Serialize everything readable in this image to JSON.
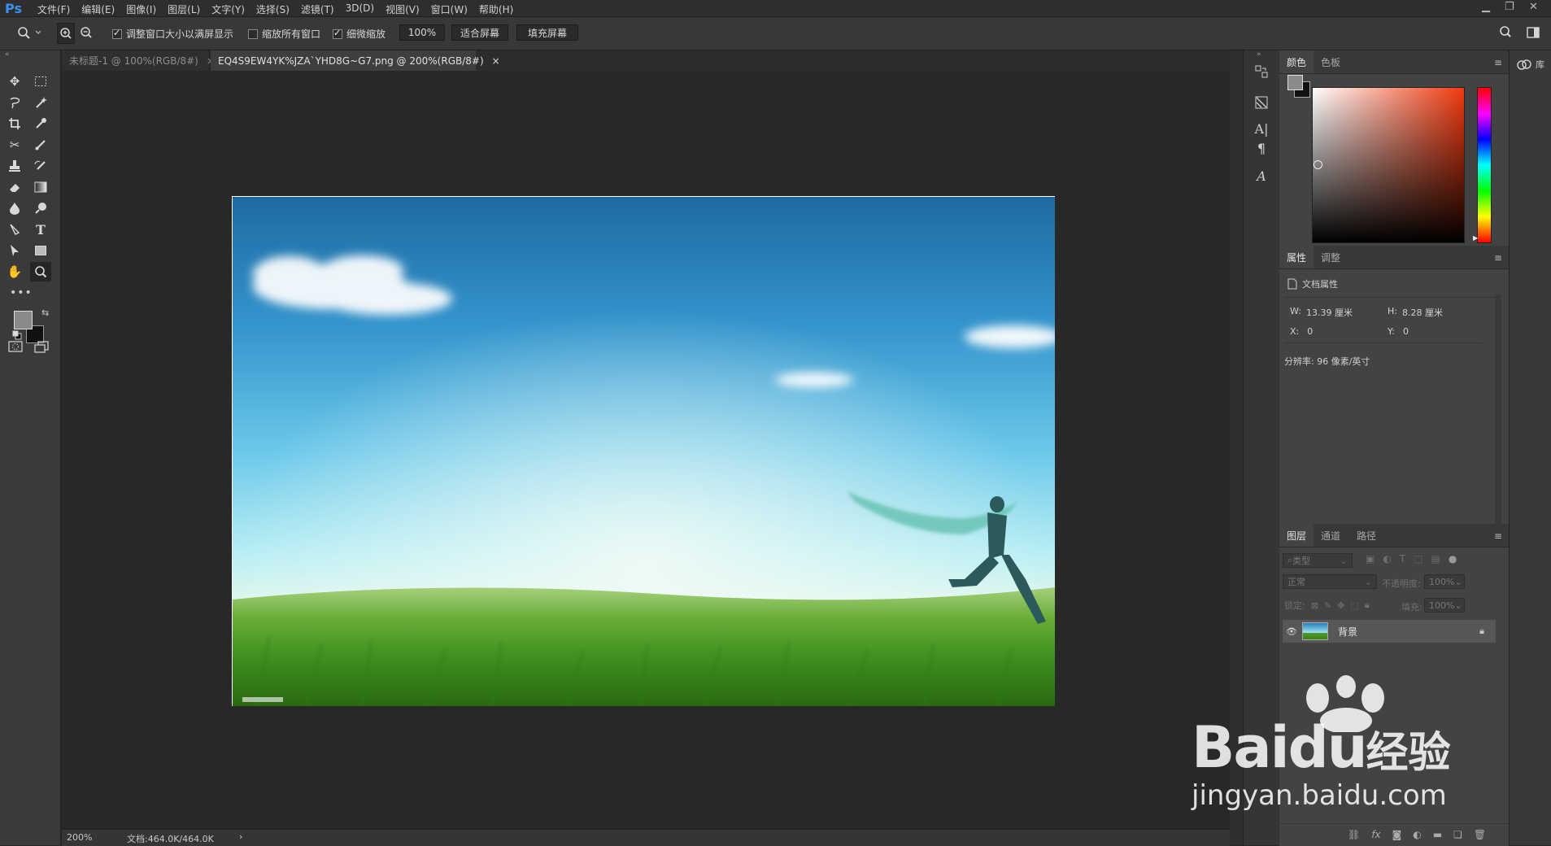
{
  "app": {
    "logo": "Ps"
  },
  "menu": [
    "文件(F)",
    "编辑(E)",
    "图像(I)",
    "图层(L)",
    "文字(Y)",
    "选择(S)",
    "滤镜(T)",
    "3D(D)",
    "视图(V)",
    "窗口(W)",
    "帮助(H)"
  ],
  "options": {
    "resize_windows_label": "调整窗口大小以满屏显示",
    "resize_windows_checked": true,
    "zoom_all_label": "缩放所有窗口",
    "zoom_all_checked": false,
    "scrubby_label": "细微缩放",
    "scrubby_checked": true,
    "zoom_value": "100%",
    "fit_screen": "适合屏幕",
    "fill_screen": "填充屏幕"
  },
  "tabs": [
    {
      "label": "未标题-1 @ 100%(RGB/8#)",
      "active": false
    },
    {
      "label": "EQ4S9EW4YK%JZA`YHD8G~G7.png @ 200%(RGB/8#)",
      "active": true
    }
  ],
  "tab_close": "×",
  "status": {
    "zoom": "200%",
    "doc": "文档:464.0K/464.0K",
    "arrow": "›"
  },
  "color_panel": {
    "tabs": [
      "颜色",
      "色板"
    ],
    "active": 0
  },
  "properties_panel": {
    "tabs": [
      "属性",
      "调整"
    ],
    "active": 0,
    "header": "文档属性",
    "w_label": "W:",
    "w_value": "13.39 厘米",
    "h_label": "H:",
    "h_value": "8.28 厘米",
    "x_label": "X:",
    "x_value": "0",
    "y_label": "Y:",
    "y_value": "0",
    "resolution": "分辨率: 96 像素/英寸"
  },
  "layers_panel": {
    "tabs": [
      "图层",
      "通道",
      "路径"
    ],
    "active": 0,
    "filter_placeholder": "类型",
    "blend_mode": "正常",
    "opacity_label": "不透明度:",
    "opacity_value": "100%",
    "lock_label": "锁定:",
    "fill_label": "填充:",
    "fill_value": "100%",
    "layer_name": "背景"
  },
  "right_strip": {
    "libraries": "库"
  },
  "watermark": {
    "brand": "Baidu",
    "brand_cn": "经验",
    "url": "jingyan.baidu.com"
  },
  "colors": {
    "foreground": "#8a8a8a",
    "background": "#111111",
    "accent": "#3a8ff0",
    "picker_hue": "#f03a10"
  }
}
